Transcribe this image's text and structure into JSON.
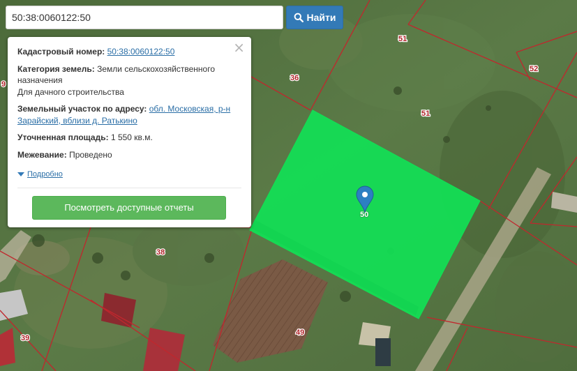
{
  "search": {
    "value": "50:38:0060122:50",
    "button_label": "Найти"
  },
  "popup": {
    "cadastral_label": "Кадастровый номер:",
    "cadastral_value": "50:38:0060122:50",
    "category_label": "Категория земель:",
    "category_value": "Земли сельскохозяйственного назначения",
    "usage_value": "Для дачного строительства",
    "address_label": "Земельный участок по адресу:",
    "address_value": "обл. Московская, р-н Зарайский, вблизи д. Ратькино",
    "area_label": "Уточненная площадь:",
    "area_value": "1 550 кв.м.",
    "survey_label": "Межевание:",
    "survey_value": "Проведено",
    "details_label": "Подробно",
    "reports_button": "Посмотреть доступные отчеты"
  },
  "map": {
    "parcel_labels": [
      "51",
      "52",
      "36",
      "9",
      "51",
      "50",
      "38",
      "39",
      "49"
    ],
    "selected_parcel": "50",
    "colors": {
      "selected_fill": "#12e055",
      "boundary": "#c0272d",
      "marker": "#2c7fc2",
      "grass": "#587544"
    }
  }
}
